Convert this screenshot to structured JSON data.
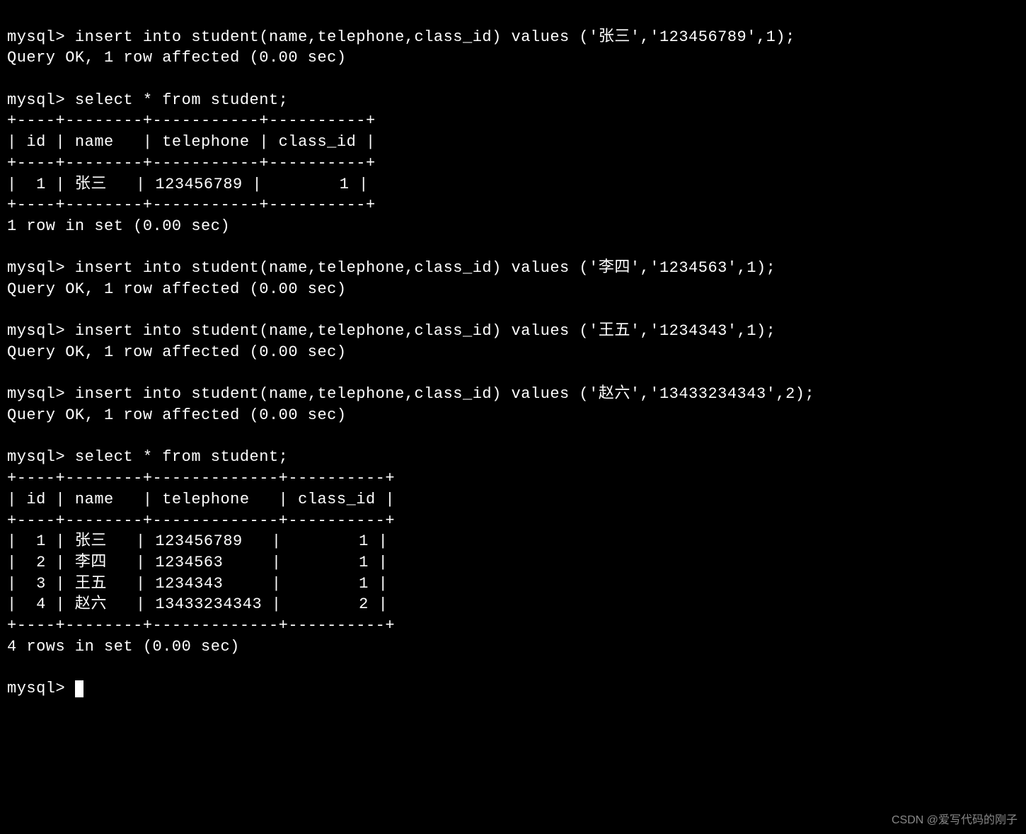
{
  "lines": {
    "l1": "mysql> insert into student(name,telephone,class_id) values ('张三','123456789',1);",
    "l2": "Query OK, 1 row affected (0.00 sec)",
    "l3": "",
    "l4": "mysql> select * from student;",
    "l5": "+----+--------+-----------+----------+",
    "l6": "| id | name   | telephone | class_id |",
    "l7": "+----+--------+-----------+----------+",
    "l8": "|  1 | 张三   | 123456789 |        1 |",
    "l9": "+----+--------+-----------+----------+",
    "l10": "1 row in set (0.00 sec)",
    "l11": "",
    "l12": "mysql> insert into student(name,telephone,class_id) values ('李四','1234563',1);",
    "l13": "Query OK, 1 row affected (0.00 sec)",
    "l14": "",
    "l15": "mysql> insert into student(name,telephone,class_id) values ('王五','1234343',1);",
    "l16": "Query OK, 1 row affected (0.00 sec)",
    "l17": "",
    "l18": "mysql> insert into student(name,telephone,class_id) values ('赵六','13433234343',2);",
    "l19": "Query OK, 1 row affected (0.00 sec)",
    "l20": "",
    "l21": "mysql> select * from student;",
    "l22": "+----+--------+-------------+----------+",
    "l23": "| id | name   | telephone   | class_id |",
    "l24": "+----+--------+-------------+----------+",
    "l25": "|  1 | 张三   | 123456789   |        1 |",
    "l26": "|  2 | 李四   | 1234563     |        1 |",
    "l27": "|  3 | 王五   | 1234343     |        1 |",
    "l28": "|  4 | 赵六   | 13433234343 |        2 |",
    "l29": "+----+--------+-------------+----------+",
    "l30": "4 rows in set (0.00 sec)",
    "l31": "",
    "prompt": "mysql> "
  },
  "watermark": "CSDN @爱写代码的刚子"
}
